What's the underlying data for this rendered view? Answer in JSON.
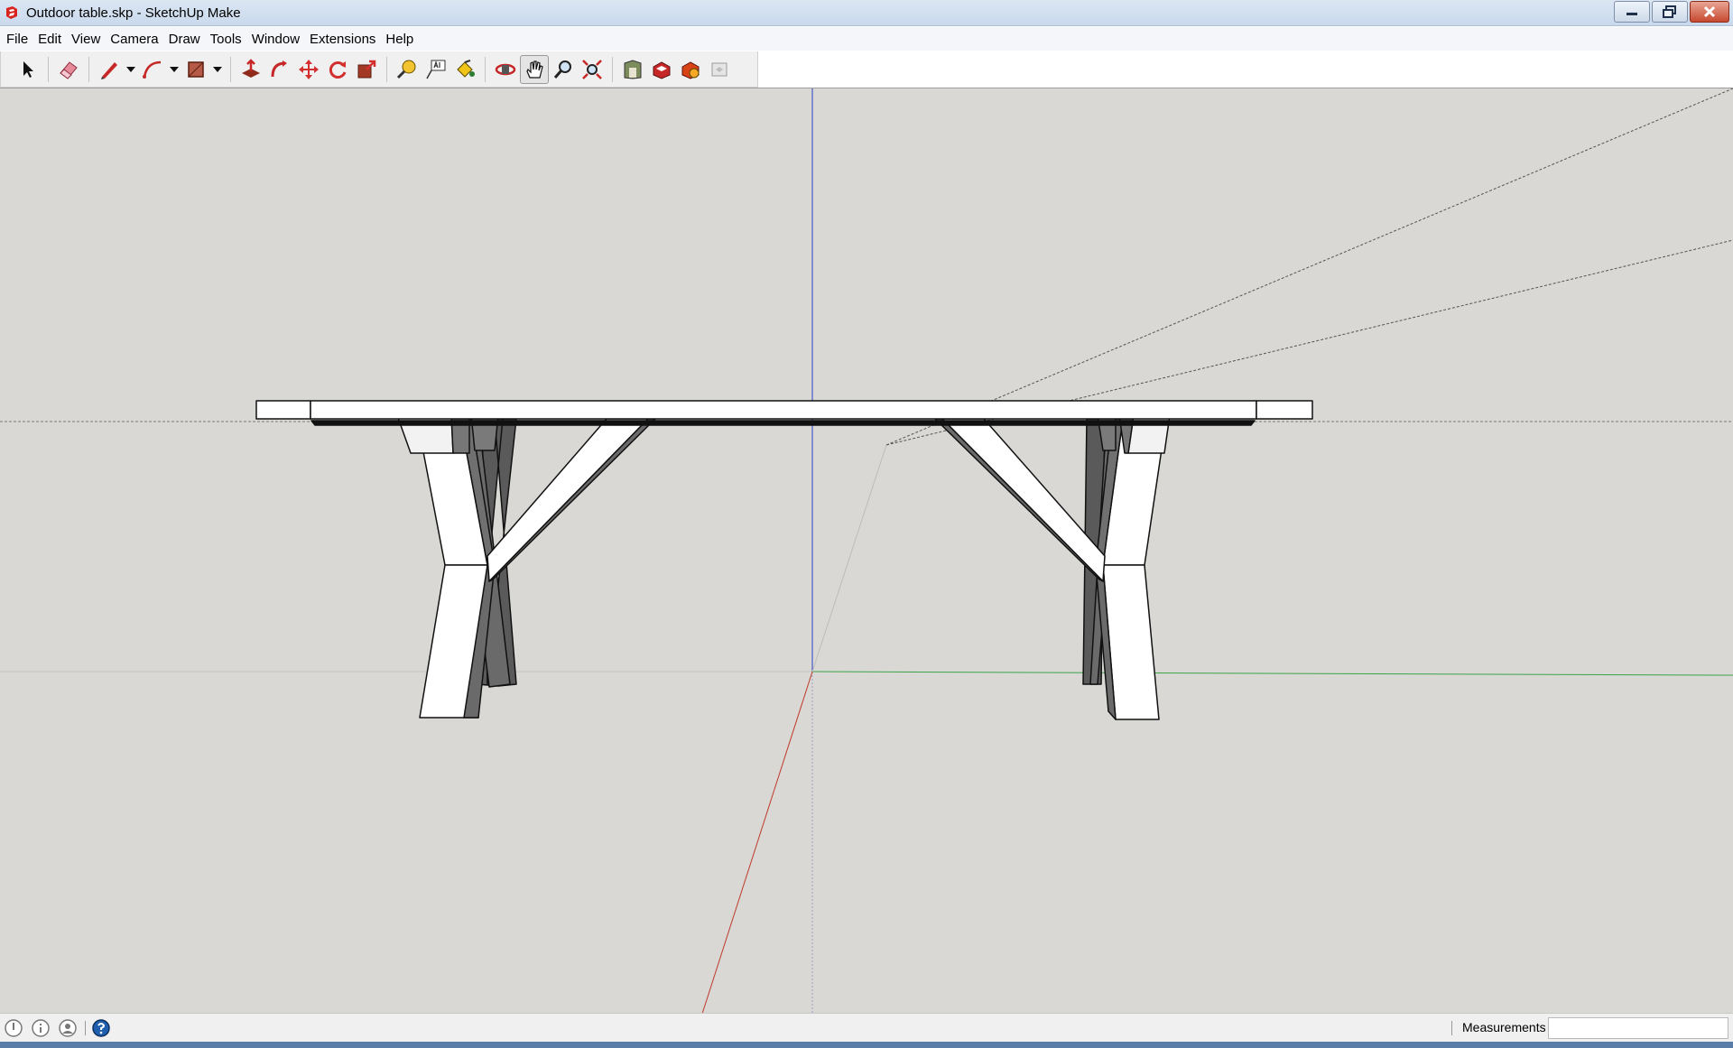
{
  "window": {
    "title": "Outdoor table.skp - SketchUp Make"
  },
  "menu": [
    "File",
    "Edit",
    "View",
    "Camera",
    "Draw",
    "Tools",
    "Window",
    "Extensions",
    "Help"
  ],
  "toolbar": {
    "tools": [
      "select-icon",
      "eraser-icon",
      "pencil-icon",
      "arc-icon",
      "rectangle-icon",
      "push-pull-icon",
      "follow-me-icon",
      "move-icon",
      "rotate-icon",
      "scale-icon",
      "tape-measure-icon",
      "text-icon",
      "paint-bucket-icon",
      "orbit-icon",
      "pan-icon",
      "zoom-icon",
      "zoom-extents-icon",
      "3d-warehouse-icon",
      "extension-warehouse-icon",
      "layout-icon",
      "share-model-icon"
    ],
    "active_tool": "pan-icon"
  },
  "status": {
    "measurements_label": "Measurements",
    "measurements_value": ""
  },
  "colors": {
    "viewport_bg": "#d9d8d4",
    "axis_red": "#c0392b",
    "axis_green": "#3aa34a",
    "axis_blue": "#2a3fc4",
    "taskbar": "#5b7ea8"
  }
}
